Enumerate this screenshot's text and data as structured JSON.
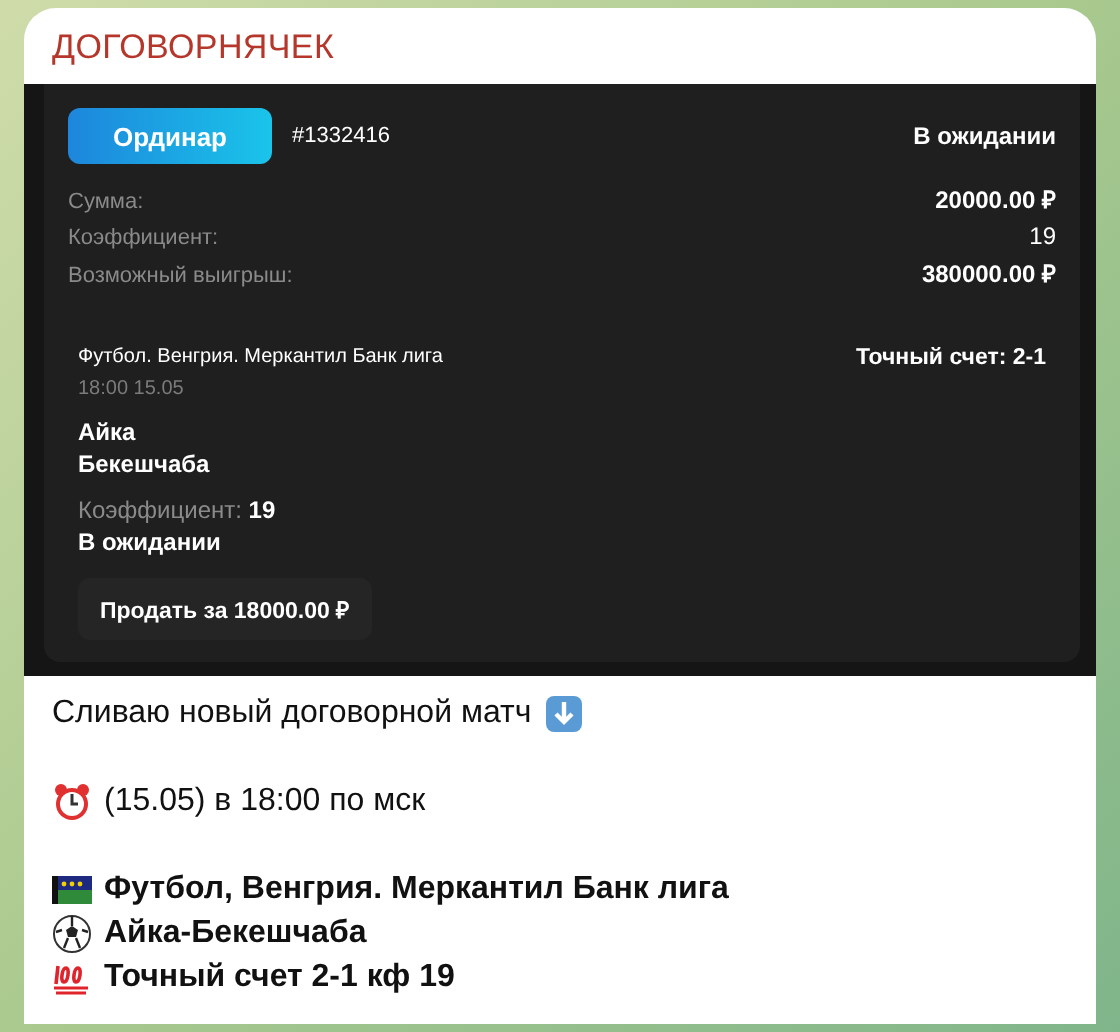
{
  "channel_title": "ДОГОВОРНЯЧЕК",
  "slip": {
    "bet_type": "Ординар",
    "id": "#1332416",
    "status": "В ожидании",
    "rows": [
      {
        "label": "Сумма:",
        "value": "20000.00 ₽",
        "bold": true
      },
      {
        "label": "Коэффициент:",
        "value": "19",
        "bold": false
      },
      {
        "label": "Возможный выигрыш:",
        "value": "380000.00 ₽",
        "bold": true
      }
    ],
    "event": {
      "league": "Футбол. Венгрия. Меркантил Банк лига",
      "market": "Точный счет: 2-1",
      "time": "18:00 15.05",
      "team_1": "Айка",
      "team_2": "Бекешчаба",
      "coef_label": "Коэффициент:",
      "coef_value": "19",
      "status": "В ожидании",
      "sell_button": "Продать за 18000.00 ₽"
    }
  },
  "message": [
    {
      "kind": "intro",
      "text": "Сливаю новый договорной матч"
    },
    {
      "kind": "time",
      "text": "(15.05) в 18:00 по мск"
    },
    {
      "kind": "league",
      "text": "Футбол, Венгрия. Меркантил Банк лига"
    },
    {
      "kind": "match",
      "text": "Айка-Бекешчаба"
    },
    {
      "kind": "pick",
      "text": "Точный счет 2-1 кф 19"
    }
  ]
}
